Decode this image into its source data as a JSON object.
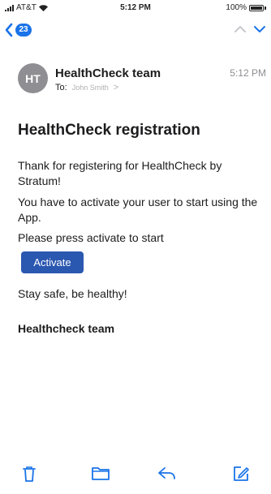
{
  "status_bar": {
    "carrier": "AT&T",
    "time": "5:12 PM",
    "battery": "100%"
  },
  "nav": {
    "unread_count": "23"
  },
  "message": {
    "avatar_initials": "HT",
    "sender": "HealthCheck team",
    "time": "5:12 PM",
    "to_label": "To:",
    "to_name": "John Smith",
    "to_chevron": ">",
    "subject": "HealthCheck registration",
    "paragraph1": "Thank for registering for HealthCheck by Stratum!",
    "paragraph2": "You have to activate your user to start using the App.",
    "paragraph3": "Please press activate to start",
    "button_label": "Activate",
    "paragraph4": "Stay safe, be healthy!",
    "signoff": "Healthcheck team"
  },
  "toolbar": {
    "icons": [
      "trash-icon",
      "folder-icon",
      "reply-icon",
      "compose-icon"
    ]
  },
  "colors": {
    "accent": "#1a73e8",
    "button": "#2a57b0",
    "avatar": "#8e8e93",
    "muted": "#8e8e93"
  }
}
